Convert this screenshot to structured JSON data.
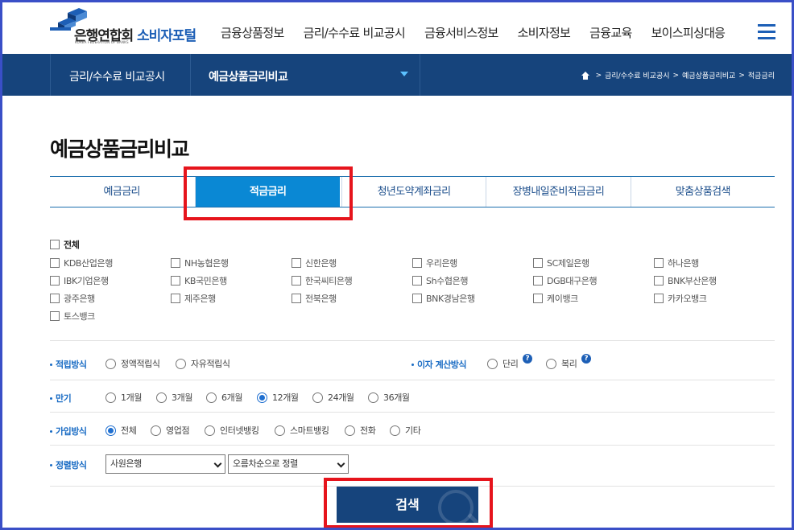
{
  "header": {
    "logo_main": "은행연합회",
    "logo_sub": "KOREA FEDERATION OF BANKS",
    "logo_portal": "소비자포털",
    "nav": [
      "금융상품정보",
      "금리/수수료 비교공시",
      "금융서비스정보",
      "소비자정보",
      "금융교육",
      "보이스피싱대응"
    ]
  },
  "subnav": {
    "level1": "금리/수수료 비교공시",
    "level2": "예금상품금리비교",
    "breadcrumb": [
      "금리/수수료 비교공시",
      "예금상품금리비교",
      "적금금리"
    ]
  },
  "page_title": "예금상품금리비교",
  "tabs": [
    "예금금리",
    "적금금리",
    "청년도약계좌금리",
    "장병내일준비적금금리",
    "맞춤상품검색"
  ],
  "active_tab": "적금금리",
  "banks": {
    "all_label": "전체",
    "rows": [
      [
        "KDB산업은행",
        "NH농협은행",
        "신한은행",
        "우리은행",
        "SC제일은행",
        "하나은행"
      ],
      [
        "IBK기업은행",
        "KB국민은행",
        "한국씨티은행",
        "Sh수협은행",
        "DGB대구은행",
        "BNK부산은행"
      ],
      [
        "광주은행",
        "제주은행",
        "전북은행",
        "BNK경남은행",
        "케이뱅크",
        "카카오뱅크"
      ],
      [
        "토스뱅크"
      ]
    ]
  },
  "options": {
    "saving_method": {
      "label": "적립방식",
      "choices": [
        "정액적립식",
        "자유적립식"
      ]
    },
    "interest_method": {
      "label": "이자 계산방식",
      "choices": [
        "단리",
        "복리"
      ]
    },
    "term": {
      "label": "만기",
      "choices": [
        "1개월",
        "3개월",
        "6개월",
        "12개월",
        "24개월",
        "36개월"
      ],
      "selected": "12개월"
    },
    "join_method": {
      "label": "가입방식",
      "choices": [
        "전체",
        "영업점",
        "인터넷뱅킹",
        "스마트뱅킹",
        "전화",
        "기타"
      ],
      "selected": "전체"
    },
    "sort": {
      "label": "정렬방식",
      "select1": "사원은행",
      "select2": "오름차순으로 정렬"
    }
  },
  "search_label": "검색",
  "colors": {
    "brand": "#16447c",
    "tab_active": "#0a88d4",
    "highlight": "#e6141c"
  }
}
